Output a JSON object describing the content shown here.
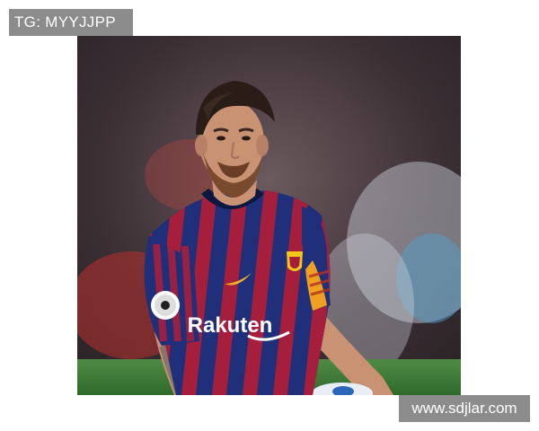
{
  "header": {
    "tag_text": "TG: MYYJJPP"
  },
  "photo": {
    "subject": "soccer-player-in-striped-jersey",
    "jersey_sponsor_text": "Rakuten",
    "colors": {
      "jersey_blue": "#1f2f7a",
      "jersey_claret": "#a51f3c",
      "armband": "#f0a020",
      "pitch": "#3f7d3a"
    }
  },
  "footer": {
    "watermark_text": "www.sdjlar.com"
  }
}
